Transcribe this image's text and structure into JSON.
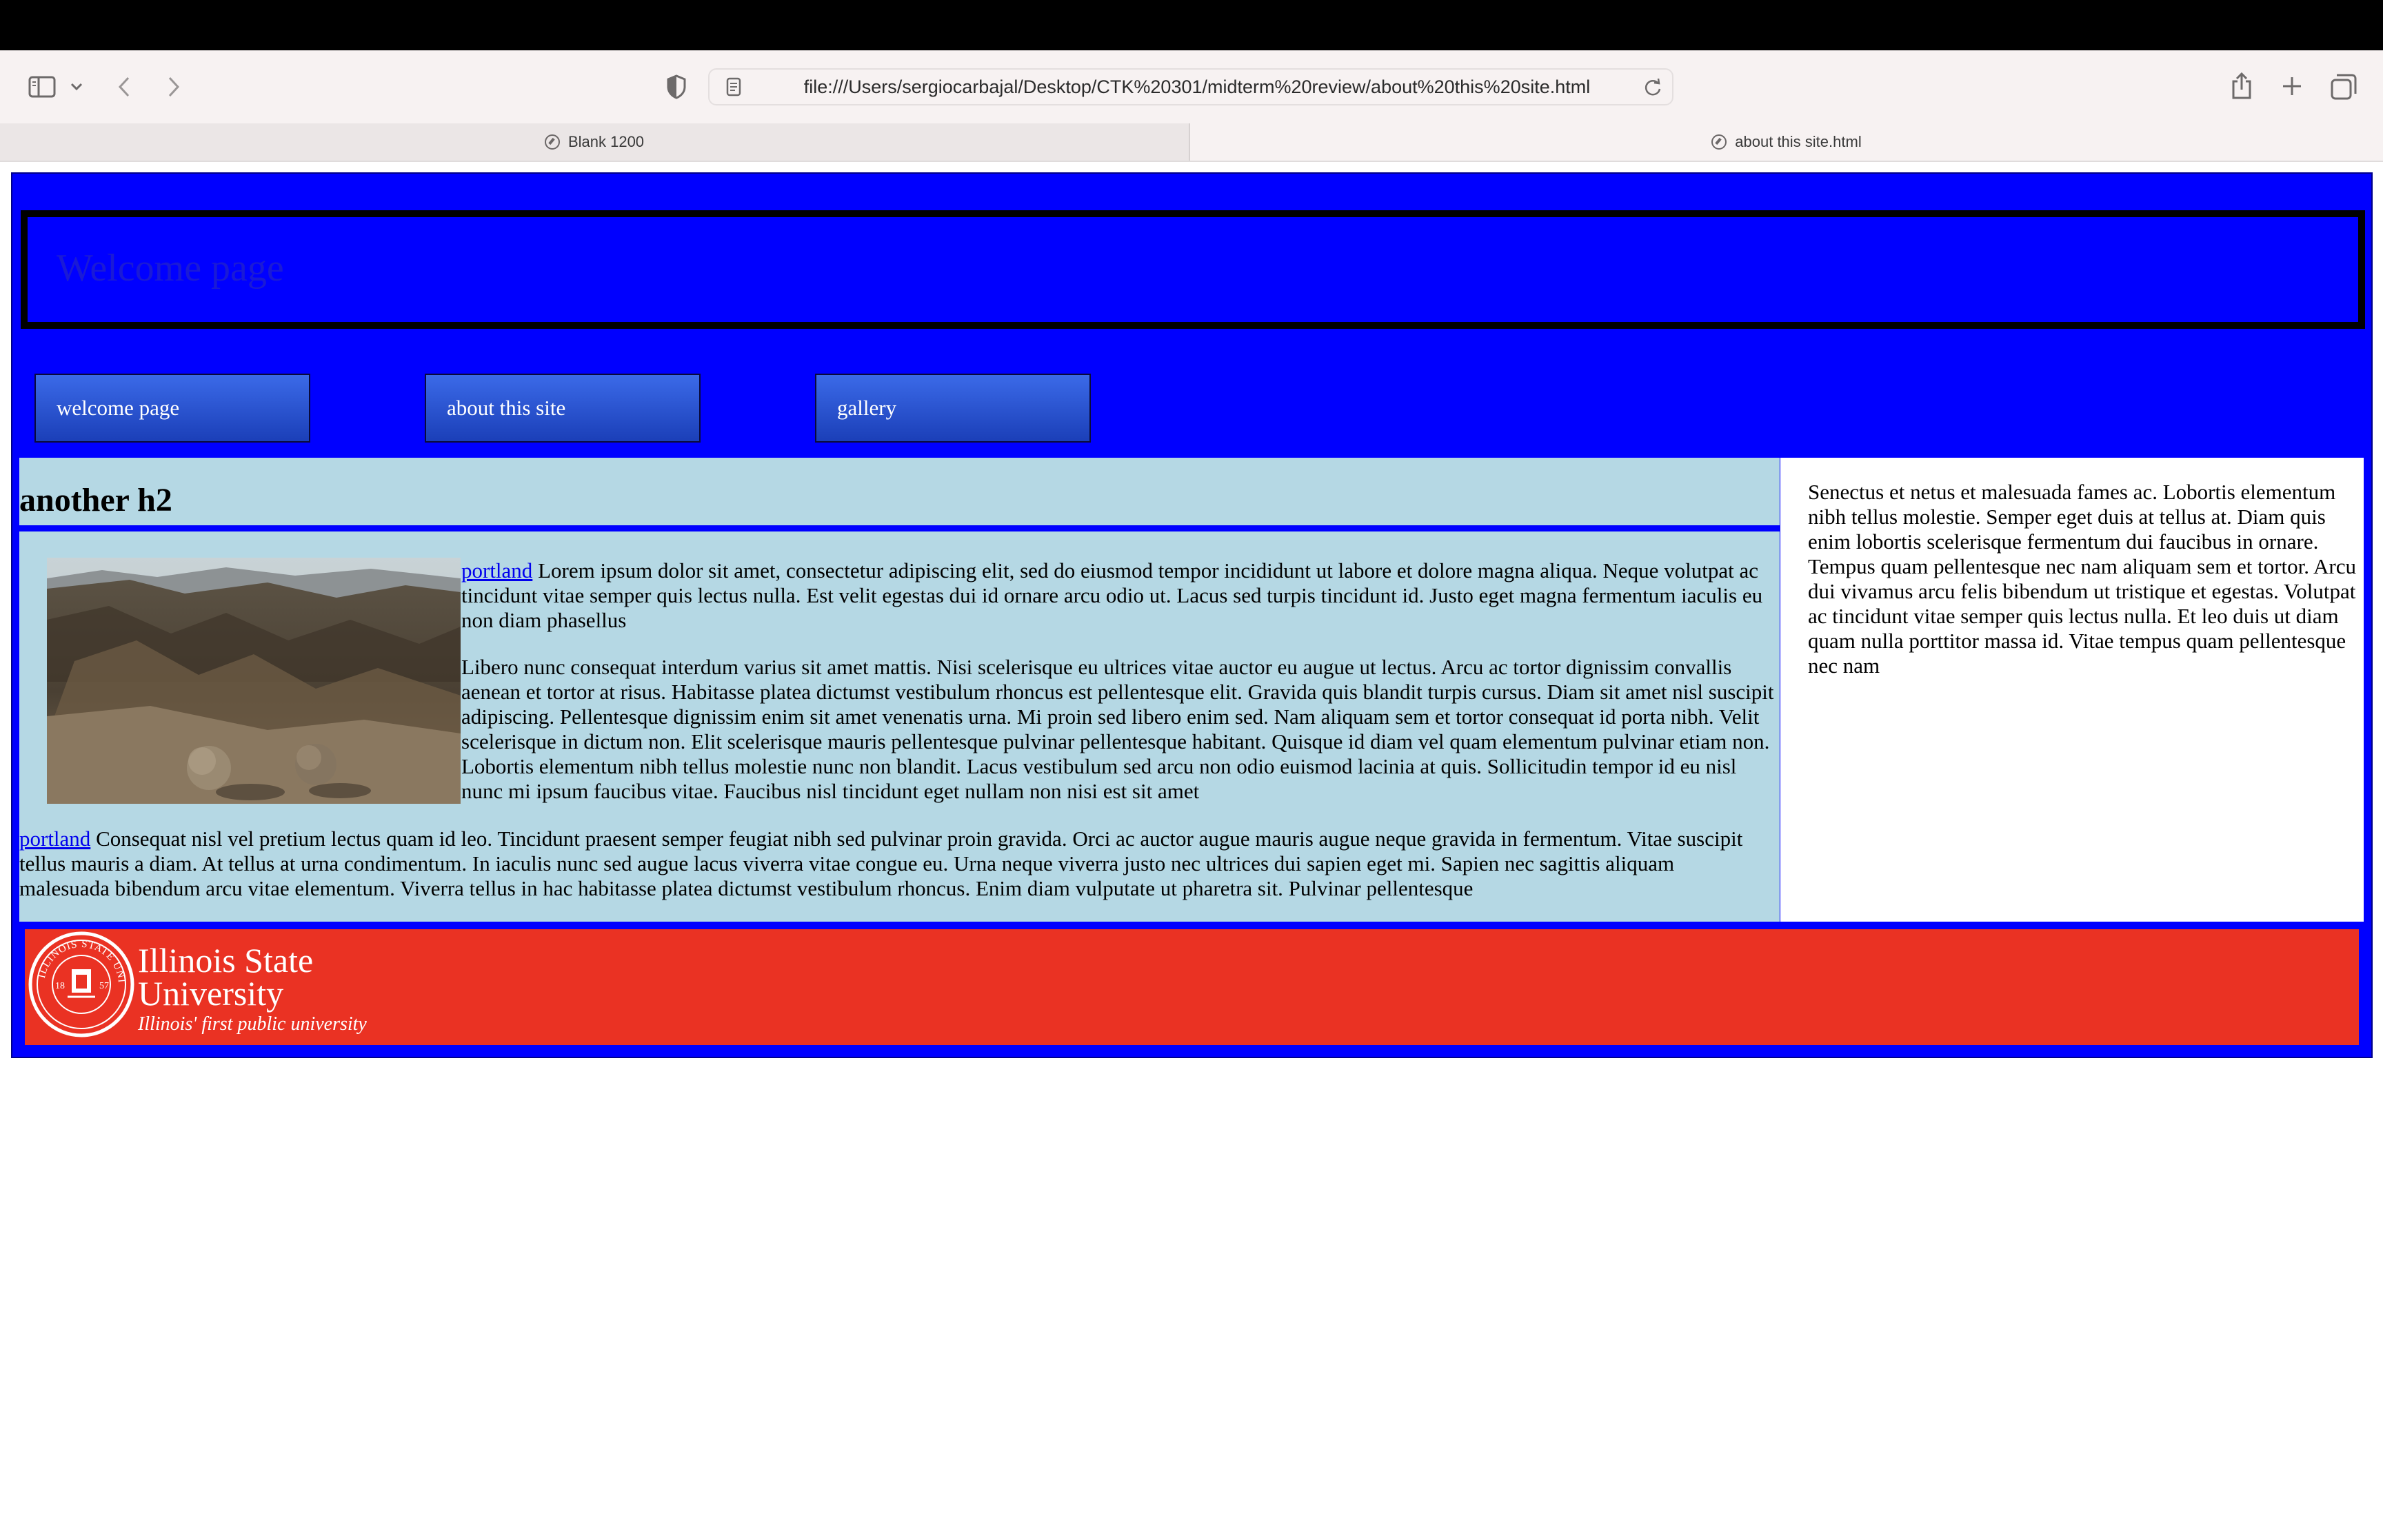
{
  "browser": {
    "url": "file:///Users/sergiocarbajal/Desktop/CTK%20301/midterm%20review/about%20this%20site.html",
    "tabs": [
      {
        "label": "Blank 1200",
        "active": false
      },
      {
        "label": "about this site.html",
        "active": true
      }
    ],
    "icons": [
      "sidebar-icon",
      "chevron-down-icon",
      "back-icon",
      "forward-icon",
      "shield-icon",
      "page-icon",
      "reload-icon",
      "share-icon",
      "plus-icon",
      "tabs-overview-icon",
      "compass-icon"
    ]
  },
  "page": {
    "header_title": "Welcome page",
    "nav": [
      {
        "label": "welcome page"
      },
      {
        "label": "about this site"
      },
      {
        "label": "gallery"
      }
    ],
    "main": {
      "heading": "another h2",
      "image_alt": "desert landscape photo",
      "para1_link": "portland",
      "para1_text": " Lorem ipsum dolor sit amet, consectetur adipiscing elit, sed do eiusmod tempor incididunt ut labore et dolore magna aliqua. Neque volutpat ac tincidunt vitae semper quis lectus nulla. Est velit egestas dui id ornare arcu odio ut. Lacus sed turpis tincidunt id. Justo eget magna fermentum iaculis eu non diam phasellus",
      "para2_text": "Libero nunc consequat interdum varius sit amet mattis. Nisi scelerisque eu ultrices vitae auctor eu augue ut lectus. Arcu ac tortor dignissim convallis aenean et tortor at risus. Habitasse platea dictumst vestibulum rhoncus est pellentesque elit. Gravida quis blandit turpis cursus. Diam sit amet nisl suscipit adipiscing. Pellentesque dignissim enim sit amet venenatis urna. Mi proin sed libero enim sed. Nam aliquam sem et tortor consequat id porta nibh. Velit scelerisque in dictum non. Elit scelerisque mauris pellentesque pulvinar pellentesque habitant. Quisque id diam vel quam elementum pulvinar etiam non. Lobortis elementum nibh tellus molestie nunc non blandit. Lacus vestibulum sed arcu non odio euismod lacinia at quis. Sollicitudin tempor id eu nisl nunc mi ipsum faucibus vitae. Faucibus nisl tincidunt eget nullam non nisi est sit amet",
      "para3_link": "portland",
      "para3_text": " Consequat nisl vel pretium lectus quam id leo. Tincidunt praesent semper feugiat nibh sed pulvinar proin gravida. Orci ac auctor augue mauris augue neque gravida in fermentum. Vitae suscipit tellus mauris a diam. At tellus at urna condimentum. In iaculis nunc sed augue lacus viverra vitae congue eu. Urna neque viverra justo nec ultrices dui sapien eget mi. Sapien nec sagittis aliquam malesuada bibendum arcu vitae elementum. Viverra tellus in hac habitasse platea dictumst vestibulum rhoncus. Enim diam vulputate ut pharetra sit. Pulvinar pellentesque"
    },
    "aside_text": "Senectus et netus et malesuada fames ac. Lobortis elementum nibh tellus molestie. Semper eget duis at tellus at. Diam quis enim lobortis scelerisque fermentum dui faucibus in ornare. Tempus quam pellentesque nec nam aliquam sem et tortor. Arcu dui vivamus arcu felis bibendum ut tristique et egestas. Volutpat ac tincidunt vitae semper quis lectus nulla. Et leo duis ut diam quam nulla porttitor massa id. Vitae tempus quam pellentesque nec nam",
    "footer_logo": {
      "line1": "Illinois State",
      "line2": "University",
      "tagline": "Illinois' first public university",
      "seal_text": "ILLINOIS STATE UNIVERSITY",
      "seal_year_left": "18",
      "seal_year_right": "57"
    },
    "colors": {
      "page_bg": "#0000ff",
      "main_bg": "#b5d8e4",
      "footer_bg": "#ea3223",
      "nav_button": "#2a52d4"
    }
  }
}
